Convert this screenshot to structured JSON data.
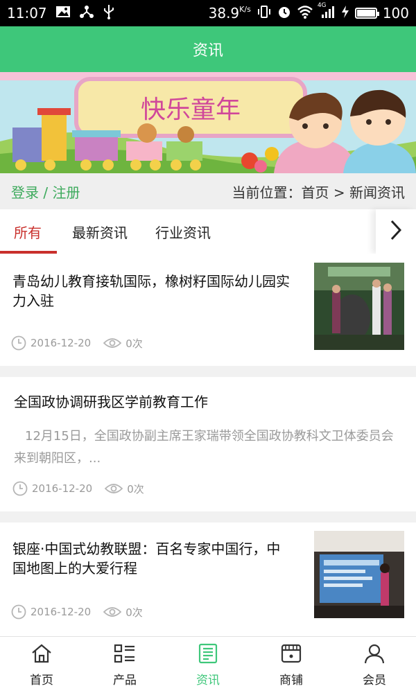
{
  "status_bar": {
    "time": "11:07",
    "speed": "38.9",
    "speed_unit": "K/s",
    "signal": "4G",
    "battery": "100",
    "battery_level": 1.0
  },
  "header": {
    "title": "资讯"
  },
  "banner": {
    "text": "快乐童年"
  },
  "location_bar": {
    "login": "登录 / 注册",
    "location": "当前位置：首页 > 新闻资讯"
  },
  "tabs": [
    {
      "label": "所有",
      "active": true
    },
    {
      "label": "最新资讯",
      "active": false
    },
    {
      "label": "行业资讯",
      "active": false
    }
  ],
  "articles": [
    {
      "title": "青岛幼儿教育接轨国际，橡树籽国际幼儿园实力入驻",
      "date": "2016-12-20",
      "views": "0次"
    },
    {
      "title": "全国政协调研我区学前教育工作",
      "summary": "12月15日，全国政协副主席王家瑞带领全国政协教科文卫体委员会来到朝阳区，...",
      "date": "2016-12-20",
      "views": "0次"
    },
    {
      "title": "银座·中国式幼教联盟：百名专家中国行，中国地图上的大爱行程",
      "date": "2016-12-20",
      "views": "0次"
    }
  ],
  "bottom_nav": [
    {
      "label": "首页",
      "icon": "home-icon",
      "active": false
    },
    {
      "label": "产品",
      "icon": "product-list-icon",
      "active": false
    },
    {
      "label": "资讯",
      "icon": "news-icon",
      "active": true
    },
    {
      "label": "商铺",
      "icon": "store-icon",
      "active": false
    },
    {
      "label": "会员",
      "icon": "member-icon",
      "active": false
    }
  ],
  "colors": {
    "brand_green": "#3ec77a",
    "login_green": "#3daa5c",
    "active_tab_red": "#c9302c"
  }
}
